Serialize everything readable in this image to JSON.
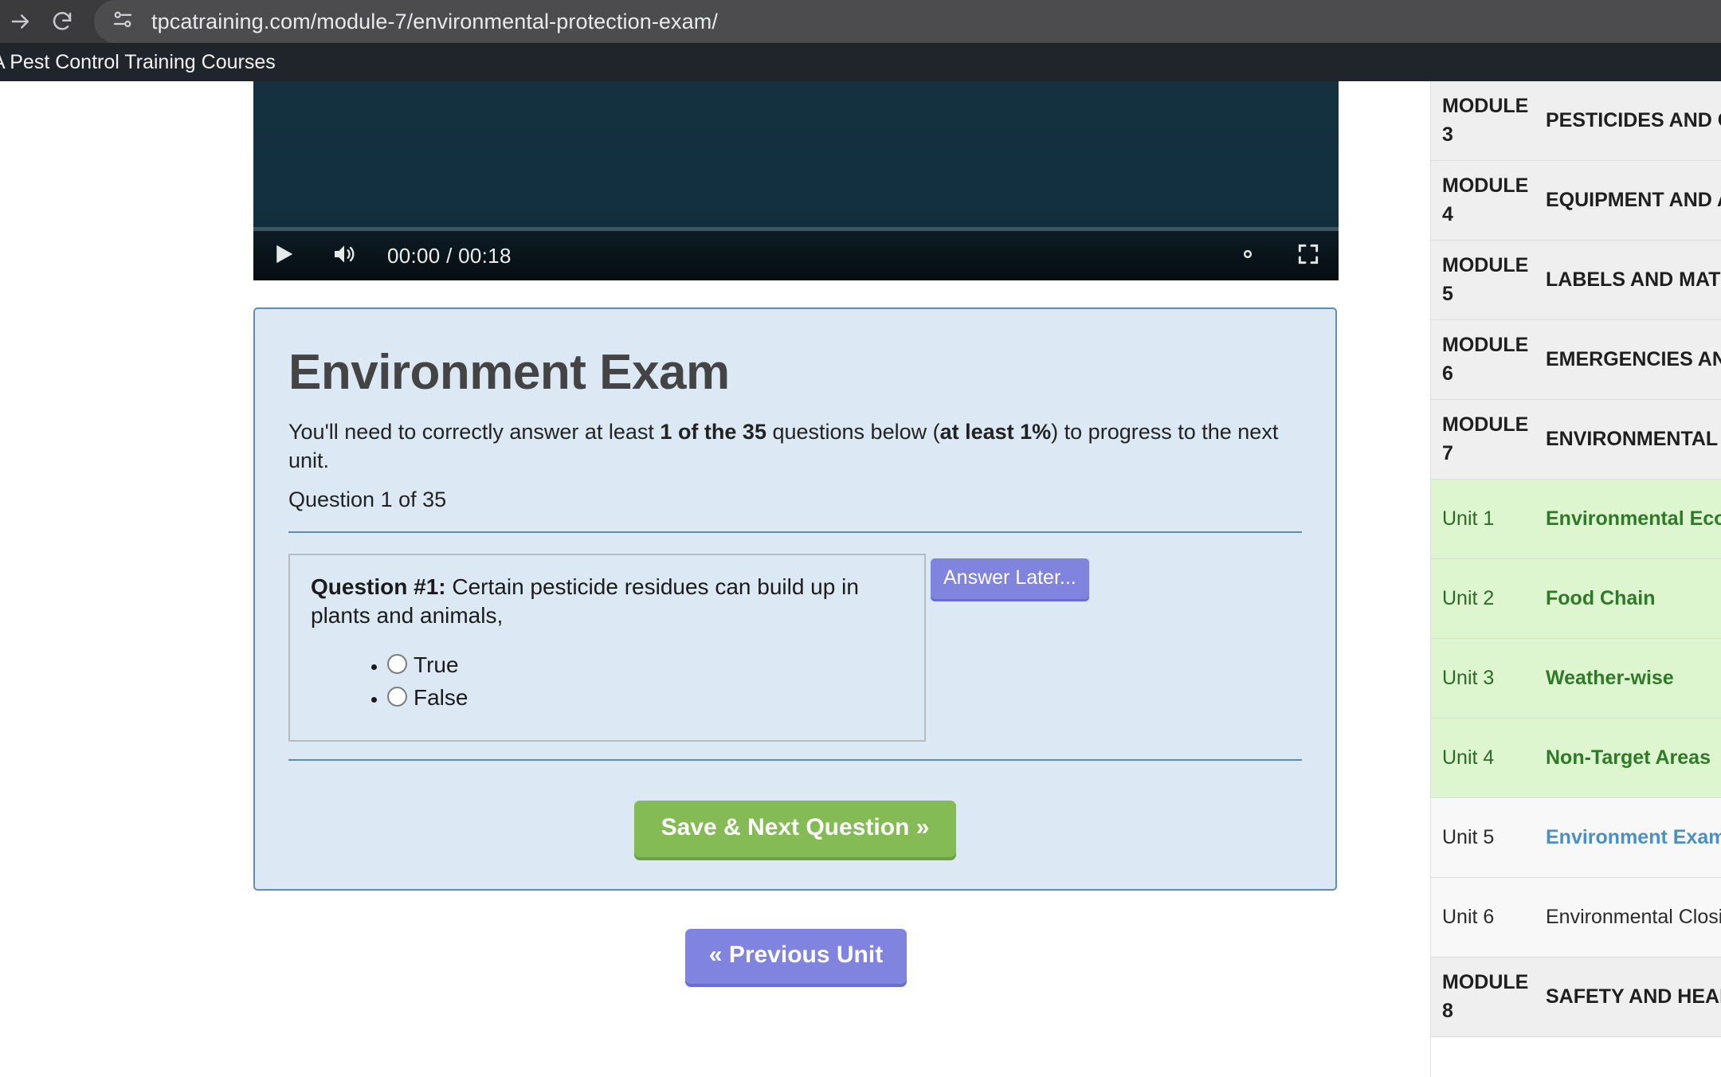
{
  "browser": {
    "url": "tpcatraining.com/module-7/environmental-protection-exam/",
    "forward_icon": "arrow-right-icon",
    "reload_icon": "reload-icon",
    "site_info_icon": "site-settings-icon"
  },
  "site_header": {
    "title": "A Pest Control Training Courses"
  },
  "video": {
    "play_icon": "play-icon",
    "volume_icon": "volume-icon",
    "time": "00:00 / 00:18",
    "settings_icon": "gear-icon",
    "fullscreen_icon": "fullscreen-icon"
  },
  "exam": {
    "title": "Environment Exam",
    "intro_part1": "You'll need to correctly answer at least ",
    "intro_bold1": "1 of the 35",
    "intro_part2": " questions below (",
    "intro_bold2": "at least 1%",
    "intro_part3": ") to progress to the next unit.",
    "question_counter": "Question 1 of 35",
    "answer_later_label": "Answer Later...",
    "save_next_label": "Save & Next Question »",
    "previous_unit_label": "« Previous Unit",
    "question": {
      "label": "Question #1:",
      "text": " Certain pesticide residues can build up in plants and animals,",
      "options": [
        {
          "label": "True",
          "selected": false
        },
        {
          "label": "False",
          "selected": false
        }
      ]
    }
  },
  "sidebar": {
    "rows": [
      {
        "type": "module",
        "num": "MODULE 3",
        "label": "PESTICIDES AND CHEMISTRY",
        "state": "module"
      },
      {
        "type": "module",
        "num": "MODULE 4",
        "label": "EQUIPMENT AND APPLICATION",
        "state": "module"
      },
      {
        "type": "module",
        "num": "MODULE 5",
        "label": "LABELS AND MATHEMATICS",
        "state": "module"
      },
      {
        "type": "module",
        "num": "MODULE 6",
        "label": "EMERGENCIES AND SPILLS",
        "state": "module"
      },
      {
        "type": "module",
        "num": "MODULE 7",
        "label": "ENVIRONMENTAL ECOLOGY",
        "state": "module"
      },
      {
        "type": "unit",
        "num": "Unit 1",
        "label": "Environmental Ecology",
        "state": "unit-done"
      },
      {
        "type": "unit",
        "num": "Unit 2",
        "label": "Food Chain",
        "state": "unit-done"
      },
      {
        "type": "unit",
        "num": "Unit 3",
        "label": "Weather-wise",
        "state": "unit-done"
      },
      {
        "type": "unit",
        "num": "Unit 4",
        "label": "Non-Target Areas",
        "state": "unit-done"
      },
      {
        "type": "unit",
        "num": "Unit 5",
        "label": "Environment Exam",
        "state": "unit-current"
      },
      {
        "type": "unit",
        "num": "Unit 6",
        "label": "Environmental Closing",
        "state": "unit-todo"
      },
      {
        "type": "module",
        "num": "MODULE 8",
        "label": "SAFETY AND HEALTH",
        "state": "module"
      }
    ]
  },
  "colors": {
    "panel_bg": "#dce9f4",
    "panel_border": "#5b8fb8",
    "green_button": "#84bb55",
    "purple_button": "#8084de",
    "unit_done_bg": "#ddf6cf",
    "unit_link": "#4a90c4"
  }
}
